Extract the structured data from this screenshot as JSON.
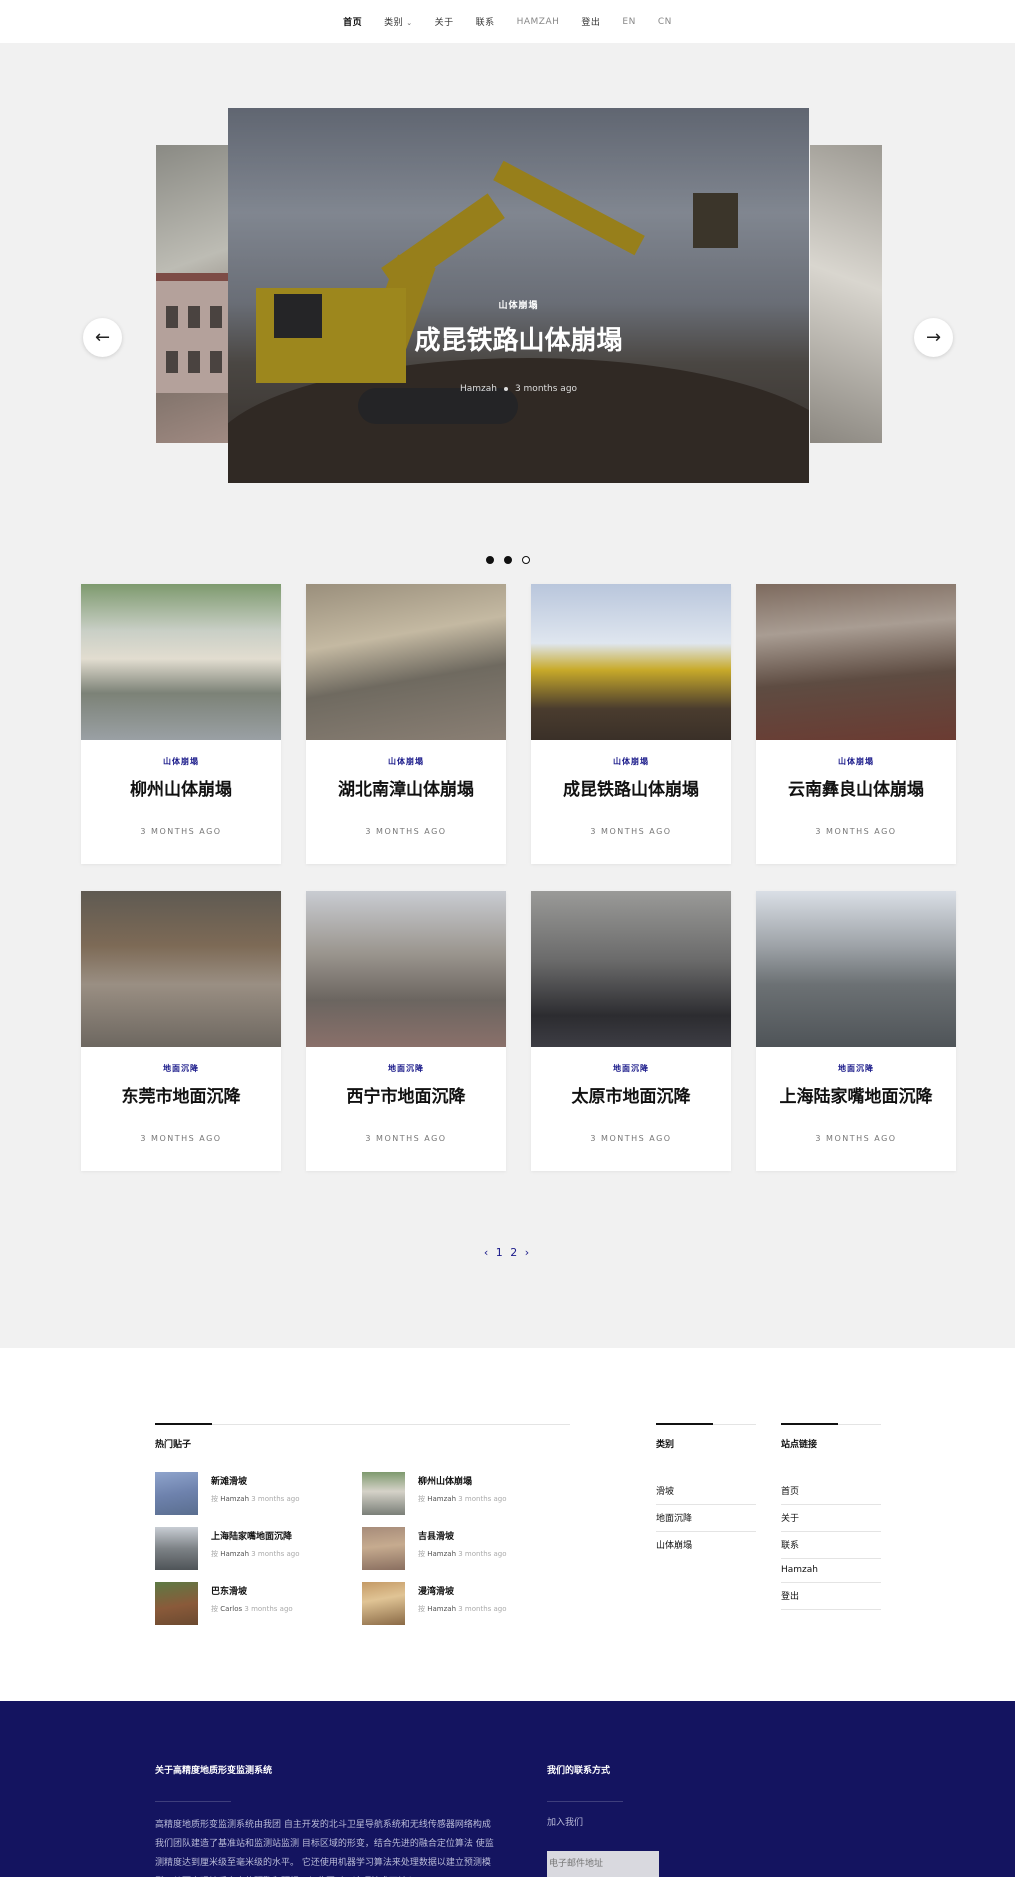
{
  "nav": {
    "items": [
      "首页",
      "类别",
      "关于",
      "联系",
      "HAMZAH",
      "登出",
      "EN",
      "CN"
    ]
  },
  "slider": {
    "category": "山体崩塌",
    "title": "成昆铁路山体崩塌",
    "author": "Hamzah",
    "time": "3 months ago",
    "prev_label": "←",
    "next_label": "→"
  },
  "posts": [
    {
      "category": "山体崩塌",
      "title": "柳州山体崩塌",
      "date": "3 MONTHS AGO",
      "thumb": "linear-gradient(180deg,#7e9a6e 0%,#c9cfc6 30%,#e2ddd0 48%,#7c8277 70%,#9aa0a4 100%)"
    },
    {
      "category": "山体崩塌",
      "title": "湖北南漳山体崩塌",
      "date": "3 MONTHS AGO",
      "thumb": "linear-gradient(170deg,#9a8f7c 0%,#c4b9a2 35%,#6f6a60 60%,#8a7f74 100%)"
    },
    {
      "category": "山体崩塌",
      "title": "成昆铁路山体崩塌",
      "date": "3 MONTHS AGO",
      "thumb": "linear-gradient(180deg,#b9c6dc 0%,#dfe6ef 38%,#c8aa2a 55%,#4a3c2e 80%,#3a3028 100%)"
    },
    {
      "category": "山体崩塌",
      "title": "云南彝良山体崩塌",
      "date": "3 MONTHS AGO",
      "thumb": "linear-gradient(175deg,#7d6a5e 0%,#a99d93 30%,#5e4c42 60%,#6b3b32 100%)"
    },
    {
      "category": "地面沉降",
      "title": "东莞市地面沉降",
      "date": "3 MONTHS AGO",
      "thumb": "linear-gradient(180deg,#5f5a52 0%,#7d6a56 35%,#9a8f83 60%,#6d6760 100%)"
    },
    {
      "category": "地面沉降",
      "title": "西宁市地面沉降",
      "date": "3 MONTHS AGO",
      "thumb": "linear-gradient(180deg,#c9ccd2 0%,#9a958e 40%,#6b6560 70%,#8a706a 100%)"
    },
    {
      "category": "地面沉降",
      "title": "太原市地面沉降",
      "date": "3 MONTHS AGO",
      "thumb": "linear-gradient(180deg,#9a9a98 0%,#6a6a6a 45%,#2c2c30 80%,#3d3d44 100%)"
    },
    {
      "category": "地面沉降",
      "title": "上海陆家嘴地面沉降",
      "date": "3 MONTHS AGO",
      "thumb": "linear-gradient(180deg,#dadfe6 0%,#9ea3a8 35%,#6c7174 60%,#4f5458 100%)"
    }
  ],
  "pagination": {
    "prev": "‹",
    "pages": [
      "1",
      "2"
    ],
    "next": "›"
  },
  "hot_posts": {
    "title": "热门贴子",
    "items": [
      {
        "title": "新滩滑坡",
        "by": "按",
        "author": "Hamzah",
        "time": "3 months ago",
        "thumb": "linear-gradient(170deg,#8fa4cc 0%,#6e82ad 50%,#5a6e8f 100%)"
      },
      {
        "title": "柳州山体崩塌",
        "by": "按",
        "author": "Hamzah",
        "time": "3 months ago",
        "thumb": "linear-gradient(180deg,#7e9a6e 0%,#d5d2c8 45%,#7a7f78 100%)"
      },
      {
        "title": "上海陆家嘴地面沉降",
        "by": "按",
        "author": "Hamzah",
        "time": "3 months ago",
        "thumb": "linear-gradient(180deg,#c8cdd4 0%,#7d8286 50%,#4f5458 100%)"
      },
      {
        "title": "吉县滑坡",
        "by": "按",
        "author": "Hamzah",
        "time": "3 months ago",
        "thumb": "linear-gradient(175deg,#a78c7a 0%,#c6ab8f 45%,#8a6f60 100%)"
      },
      {
        "title": "巴东滑坡",
        "by": "按",
        "author": "Carlos",
        "time": "3 months ago",
        "thumb": "linear-gradient(170deg,#5d7a44 0%,#8a5a3a 55%,#6b4a30 100%)"
      },
      {
        "title": "漫湾滑坡",
        "by": "按",
        "author": "Hamzah",
        "time": "3 months ago",
        "thumb": "linear-gradient(170deg,#c49a66 0%,#e0c495 40%,#8a6a46 100%)"
      }
    ]
  },
  "categories": {
    "title": "类别",
    "items": [
      "滑坡",
      "地面沉降",
      "山体崩塌"
    ]
  },
  "site_links": {
    "title": "站点链接",
    "items": [
      "首页",
      "关于",
      "联系",
      "Hamzah",
      "登出"
    ]
  },
  "footer": {
    "about_title": "关于高精度地质形变监测系统",
    "about_text": "高精度地质形变监测系统由我团 自主开发的北斗卫星导航系统和无线传感器网络构成 我们团队建造了基准站和监测站监测 目标区域的形变，结合先进的融合定位算法 使监测精度达到厘米级至毫米级的水平。 它还使用机器学习算法来处理数据以建立预测模型，从而实现地质灾害的预警和预报。与此同时，这项技术可被入",
    "contact_title": "我们的联系方式",
    "join_label": "加入我们",
    "email_placeholder": "电子邮件地址"
  }
}
